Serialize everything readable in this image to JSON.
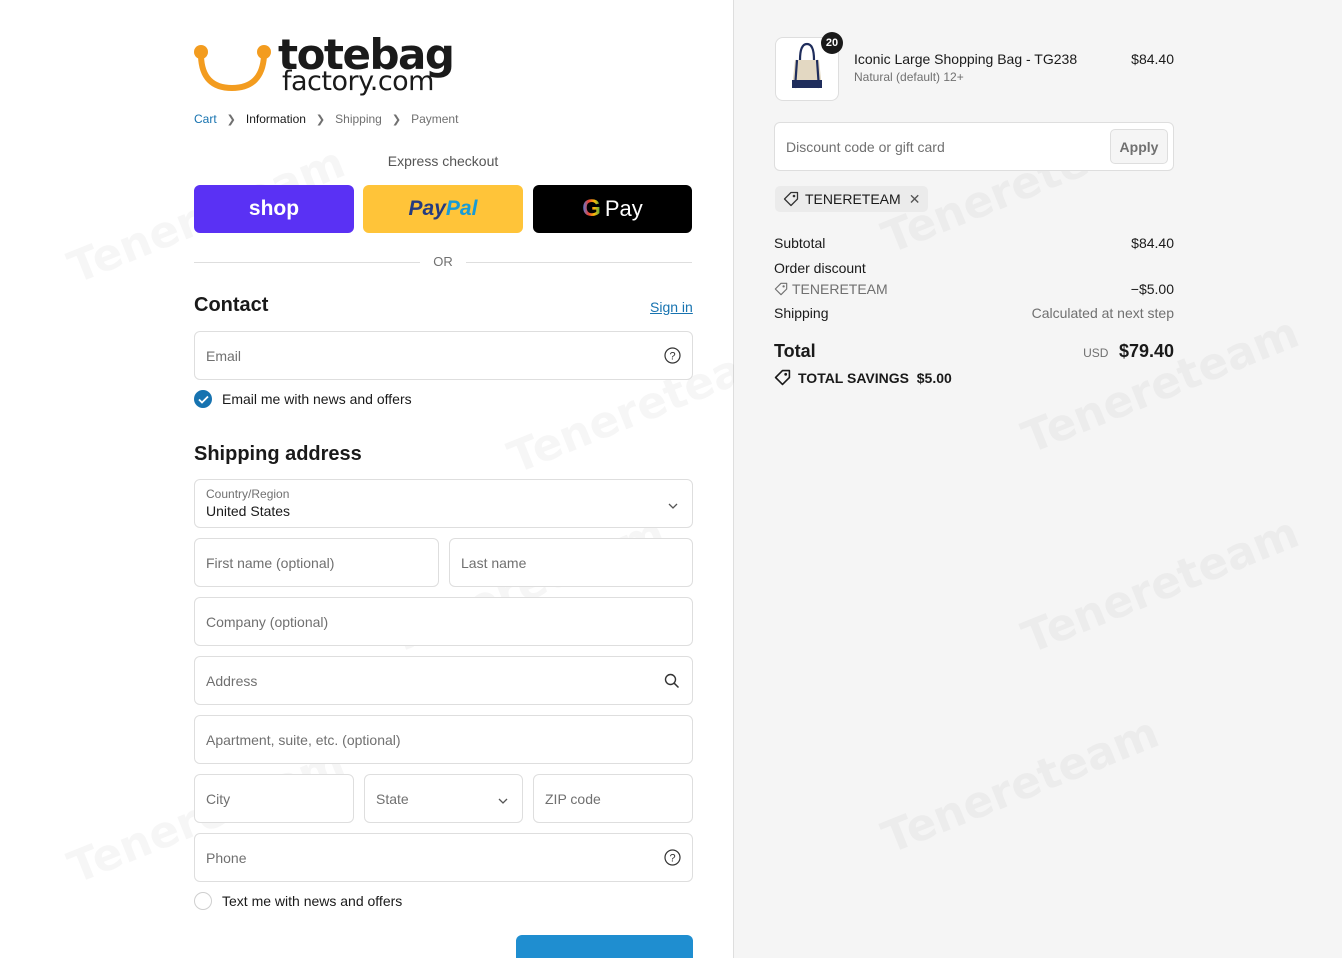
{
  "brand": {
    "word": "totebag",
    "sub": "factory.com",
    "accent": "#f39c1f"
  },
  "breadcrumb": [
    {
      "label": "Cart",
      "state": "link"
    },
    {
      "label": "Information",
      "state": "current"
    },
    {
      "label": "Shipping",
      "state": "muted"
    },
    {
      "label": "Payment",
      "state": "muted"
    }
  ],
  "express": {
    "label": "Express checkout",
    "shop": "shop",
    "paypal_a": "Pay",
    "paypal_b": "Pal",
    "gpay_g": "G",
    "gpay_text": "Pay",
    "or": "OR"
  },
  "contact": {
    "title": "Contact",
    "sign_in": "Sign in",
    "email_placeholder": "Email",
    "newsletter": "Email me with news and offers",
    "newsletter_checked": true
  },
  "shipping": {
    "title": "Shipping address",
    "country_label": "Country/Region",
    "country_value": "United States",
    "first_name": "First name (optional)",
    "last_name": "Last name",
    "company": "Company (optional)",
    "address": "Address",
    "apartment": "Apartment, suite, etc. (optional)",
    "city": "City",
    "state": "State",
    "zip": "ZIP code",
    "phone": "Phone",
    "sms": "Text me with news and offers",
    "sms_checked": false
  },
  "cart": {
    "item": {
      "name": "Iconic Large Shopping Bag - TG238",
      "variant": "Natural (default) 12+",
      "price": "$84.40",
      "qty": "20"
    },
    "discount_placeholder": "Discount code or gift card",
    "apply": "Apply",
    "code": "TENERETEAM",
    "subtotal_label": "Subtotal",
    "subtotal": "$84.40",
    "order_discount_label": "Order discount",
    "discount_code": "TENERETEAM",
    "discount_amount": "−$5.00",
    "shipping_label": "Shipping",
    "shipping_value": "Calculated at next step",
    "total_label": "Total",
    "currency": "USD",
    "total": "$79.40",
    "savings": "TOTAL SAVINGS  $5.00"
  },
  "watermark": "Tenereteam"
}
